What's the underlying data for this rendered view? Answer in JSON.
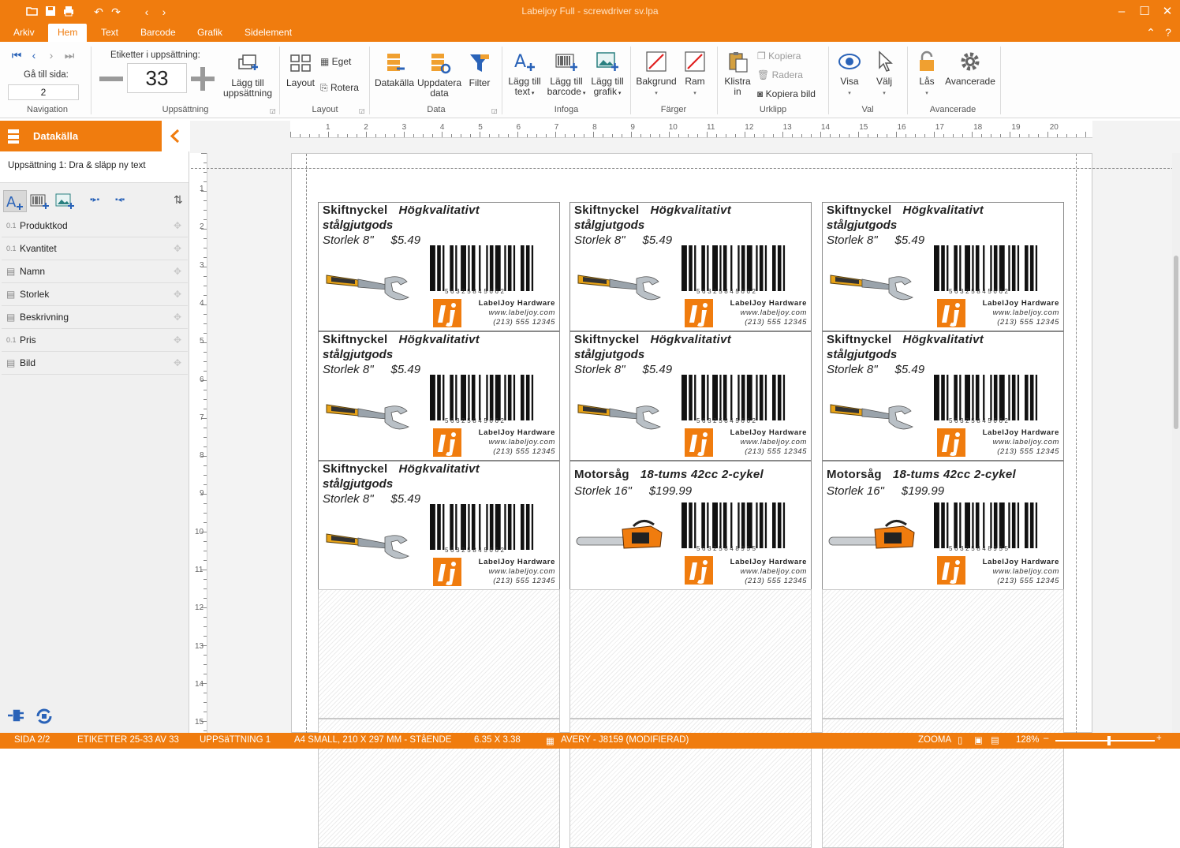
{
  "window": {
    "title": "Labeljoy Full - screwdriver sv.lpa"
  },
  "menu": {
    "tabs": [
      "Arkiv",
      "Hem",
      "Text",
      "Barcode",
      "Grafik",
      "Sidelement"
    ],
    "active": "Hem"
  },
  "ribbon": {
    "navigation": {
      "goto_label": "Gå till sida:",
      "page_value": "2",
      "group_label": "Navigation"
    },
    "uppsattning": {
      "count_label": "Etiketter i uppsättning:",
      "count_value": "33",
      "add_label_1": "Lägg till",
      "add_label_2": "uppsättning",
      "group_label": "Uppsättning"
    },
    "layout": {
      "layout_label": "Layout",
      "eget_label": "Eget",
      "rotera_label": "Rotera",
      "group_label": "Layout"
    },
    "data": {
      "datakalla_label": "Datakälla",
      "uppdatera_label_1": "Uppdatera",
      "uppdatera_label_2": "data",
      "filter_label": "Filter",
      "group_label": "Data"
    },
    "infoga": {
      "text_1": "Lägg till",
      "text_2": "text",
      "barcode_1": "Lägg till",
      "barcode_2": "barcode",
      "grafik_1": "Lägg till",
      "grafik_2": "grafik",
      "group_label": "Infoga"
    },
    "farger": {
      "bakgrund_label": "Bakgrund",
      "ram_label": "Ram",
      "group_label": "Färger"
    },
    "urklipp": {
      "klistra_1": "Klistra",
      "klistra_2": "in",
      "kopiera_label": "Kopiera",
      "radera_label": "Radera",
      "kopiera_bild_label": "Kopiera bild",
      "group_label": "Urklipp"
    },
    "val": {
      "visa_label": "Visa",
      "valj_label": "Välj",
      "group_label": "Val"
    },
    "avancerade": {
      "las_label": "Lås",
      "avancerade_label": "Avancerade",
      "group_label": "Avancerade"
    }
  },
  "panel": {
    "title": "Datakälla",
    "subtitle": "Uppsättning 1: Dra & släpp ny text",
    "fields": [
      {
        "type": "0.1",
        "label": "Produktkod"
      },
      {
        "type": "0.1",
        "label": "Kvantitet"
      },
      {
        "type": "",
        "label": "Namn"
      },
      {
        "type": "",
        "label": "Storlek"
      },
      {
        "type": "",
        "label": "Beskrivning"
      },
      {
        "type": "0.1",
        "label": "Pris"
      },
      {
        "type": "",
        "label": "Bild"
      }
    ]
  },
  "rulers": {
    "horizontal": [
      "1",
      "2",
      "3",
      "4",
      "5",
      "6",
      "7",
      "8",
      "9",
      "10",
      "11",
      "12",
      "13",
      "14",
      "15",
      "16",
      "17",
      "18",
      "19",
      "20"
    ],
    "vertical": [
      "1",
      "2",
      "3",
      "4",
      "5",
      "6",
      "7",
      "8",
      "9",
      "10",
      "11",
      "12",
      "13",
      "14",
      "15"
    ]
  },
  "labels": [
    {
      "name": "Skiftnyckel",
      "desc1": "Högkvalitativt",
      "desc2": "stålgjutgods",
      "size": "Storlek 8\"",
      "price": "$5.49",
      "barcode": "56325845662",
      "company": "LabelJoy Hardware",
      "web": "www.labeljoy.com",
      "phone": "(213) 555 12345",
      "image": "wrench-image"
    },
    {
      "name": "Skiftnyckel",
      "desc1": "Högkvalitativt",
      "desc2": "stålgjutgods",
      "size": "Storlek 8\"",
      "price": "$5.49",
      "barcode": "56325845662",
      "company": "LabelJoy Hardware",
      "web": "www.labeljoy.com",
      "phone": "(213) 555 12345",
      "image": "wrench-image"
    },
    {
      "name": "Skiftnyckel",
      "desc1": "Högkvalitativt",
      "desc2": "stålgjutgods",
      "size": "Storlek 8\"",
      "price": "$5.49",
      "barcode": "56325845662",
      "company": "LabelJoy Hardware",
      "web": "www.labeljoy.com",
      "phone": "(213) 555 12345",
      "image": "wrench-image"
    },
    {
      "name": "Skiftnyckel",
      "desc1": "Högkvalitativt",
      "desc2": "stålgjutgods",
      "size": "Storlek 8\"",
      "price": "$5.49",
      "barcode": "56325845662",
      "company": "LabelJoy Hardware",
      "web": "www.labeljoy.com",
      "phone": "(213) 555 12345",
      "image": "wrench-image"
    },
    {
      "name": "Skiftnyckel",
      "desc1": "Högkvalitativt",
      "desc2": "stålgjutgods",
      "size": "Storlek 8\"",
      "price": "$5.49",
      "barcode": "56325845662",
      "company": "LabelJoy Hardware",
      "web": "www.labeljoy.com",
      "phone": "(213) 555 12345",
      "image": "wrench-image"
    },
    {
      "name": "Skiftnyckel",
      "desc1": "Högkvalitativt",
      "desc2": "stålgjutgods",
      "size": "Storlek 8\"",
      "price": "$5.49",
      "barcode": "56325845662",
      "company": "LabelJoy Hardware",
      "web": "www.labeljoy.com",
      "phone": "(213) 555 12345",
      "image": "wrench-image"
    },
    {
      "name": "Skiftnyckel",
      "desc1": "Högkvalitativt",
      "desc2": "stålgjutgods",
      "size": "Storlek 8\"",
      "price": "$5.49",
      "barcode": "56325845662",
      "company": "LabelJoy Hardware",
      "web": "www.labeljoy.com",
      "phone": "(213) 555 12345",
      "image": "wrench-image"
    },
    {
      "name": "Motorsåg",
      "desc1": "18-tums 42cc 2-cykel",
      "desc2": "",
      "size": "Storlek 16\"",
      "price": "$199.99",
      "barcode": "56325848955",
      "company": "LabelJoy Hardware",
      "web": "www.labeljoy.com",
      "phone": "(213) 555 12345",
      "image": "chainsaw-image"
    },
    {
      "name": "Motorsåg",
      "desc1": "18-tums 42cc 2-cykel",
      "desc2": "",
      "size": "Storlek 16\"",
      "price": "$199.99",
      "barcode": "56325848955",
      "company": "LabelJoy Hardware",
      "web": "www.labeljoy.com",
      "phone": "(213) 555 12345",
      "image": "chainsaw-image"
    }
  ],
  "statusbar": {
    "page": "SIDA 2/2",
    "labels": "ETIKETTER 25-33 AV 33",
    "set": "UPPSäTTNING 1",
    "paper": "A4 SMALL, 210 X 297 MM - STåENDE",
    "size": "6.35 X 3.38",
    "template": "AVERY - J8159 (MODIFIERAD)",
    "zoom_label": "ZOOMA",
    "zoom_value": "128%"
  },
  "colors": {
    "accent": "#f07c0e"
  }
}
